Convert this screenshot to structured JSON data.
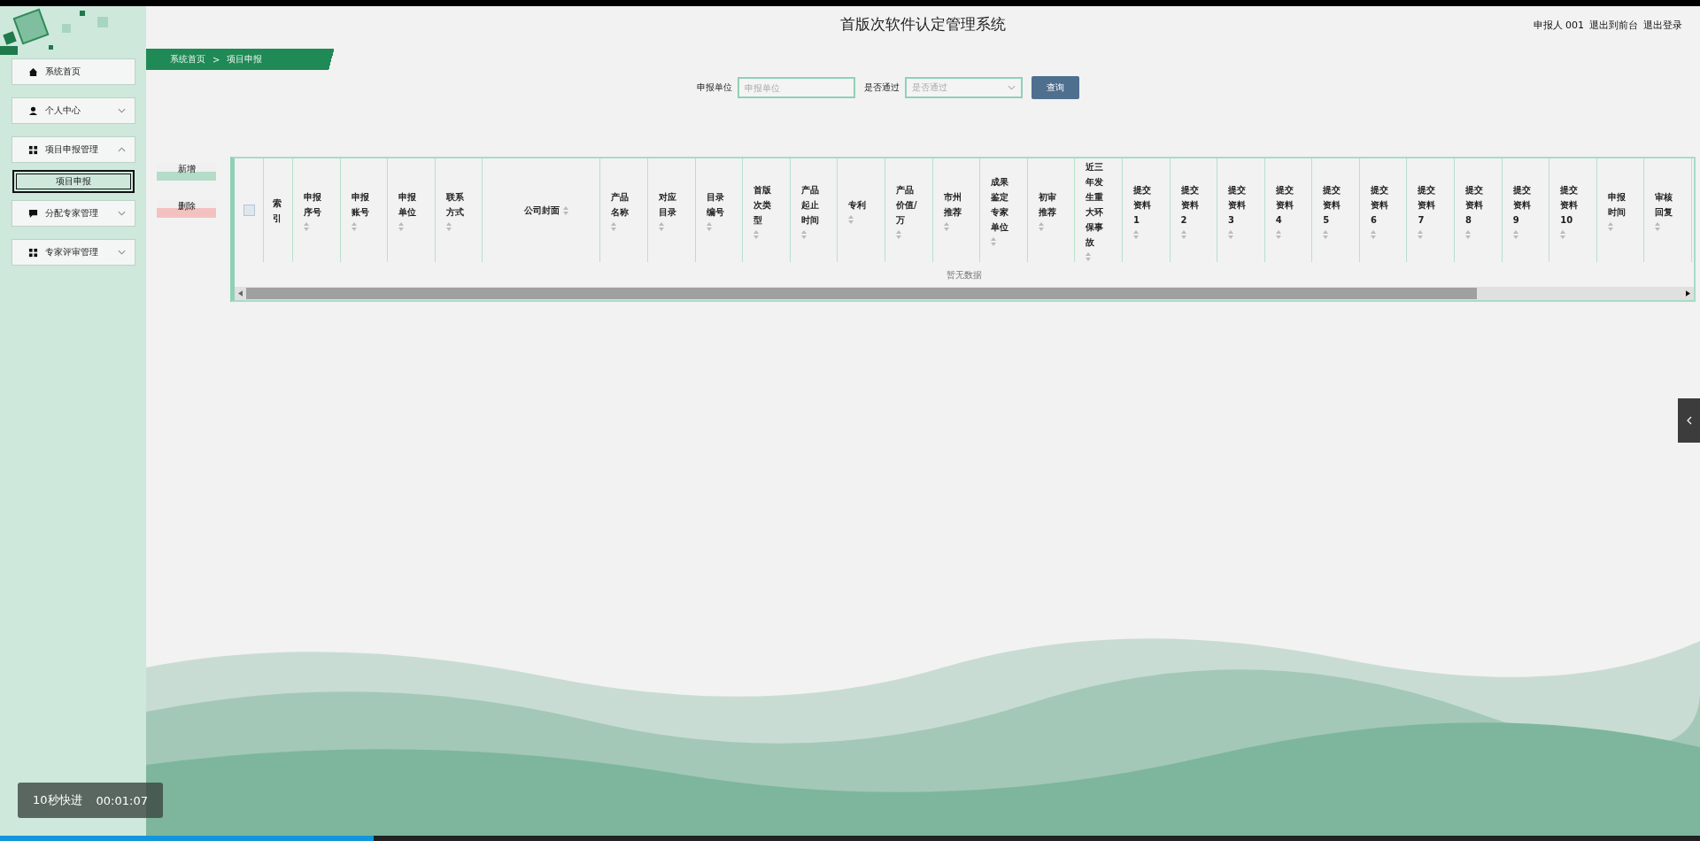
{
  "header": {
    "title": "首版次软件认定管理系统",
    "links": [
      "申报人 001",
      "退出到前台",
      "退出登录"
    ]
  },
  "breadcrumb": {
    "items": [
      "系统首页",
      "项目申报"
    ],
    "separator": ">"
  },
  "sidebar": {
    "items": [
      {
        "label": "系统首页",
        "kind": "link"
      },
      {
        "label": "个人中心",
        "kind": "menu",
        "expanded": false
      },
      {
        "label": "项目申报管理",
        "kind": "menu",
        "expanded": true,
        "children": [
          {
            "label": "项目申报",
            "selected": true
          }
        ]
      },
      {
        "label": "分配专家管理",
        "kind": "menu",
        "expanded": false
      },
      {
        "label": "专家评审管理",
        "kind": "menu",
        "expanded": false
      }
    ]
  },
  "search": {
    "fields": [
      {
        "label": "申报单位",
        "placeholder": "申报单位",
        "kind": "input"
      },
      {
        "label": "是否通过",
        "placeholder": "是否通过",
        "kind": "select"
      }
    ],
    "button": "查询"
  },
  "actions": [
    {
      "label": "新增",
      "kind": "add"
    },
    {
      "label": "删除",
      "kind": "delete"
    }
  ],
  "table": {
    "select_all": {
      "checked": false
    },
    "columns": [
      {
        "label": "索引",
        "sortable": false,
        "kind": "narrow"
      },
      {
        "label": "申报序号",
        "sortable": true
      },
      {
        "label": "申报账号",
        "sortable": true
      },
      {
        "label": "申报单位",
        "sortable": true
      },
      {
        "label": "联系方式",
        "sortable": true
      },
      {
        "label": "公司封面",
        "sortable": true,
        "kind": "wide"
      },
      {
        "label": "产品名称",
        "sortable": true
      },
      {
        "label": "对应目录",
        "sortable": true
      },
      {
        "label": "目录编号",
        "sortable": true
      },
      {
        "label": "首版次类型",
        "sortable": true
      },
      {
        "label": "产品起止时间",
        "sortable": true
      },
      {
        "label": "专利",
        "sortable": true
      },
      {
        "label": "产品价值/万",
        "sortable": true
      },
      {
        "label": "市州推荐",
        "sortable": true
      },
      {
        "label": "成果鉴定专家单位",
        "sortable": true
      },
      {
        "label": "初审推荐",
        "sortable": true
      },
      {
        "label": "近三年发生重大环保事故",
        "sortable": true
      },
      {
        "label": "提交资料1",
        "sortable": true
      },
      {
        "label": "提交资料2",
        "sortable": true
      },
      {
        "label": "提交资料3",
        "sortable": true
      },
      {
        "label": "提交资料4",
        "sortable": true
      },
      {
        "label": "提交资料5",
        "sortable": true
      },
      {
        "label": "提交资料6",
        "sortable": true
      },
      {
        "label": "提交资料7",
        "sortable": true
      },
      {
        "label": "提交资料8",
        "sortable": true
      },
      {
        "label": "提交资料9",
        "sortable": true
      },
      {
        "label": "提交资料10",
        "sortable": true
      },
      {
        "label": "申报时间",
        "sortable": true
      },
      {
        "label": "审核回复",
        "sortable": true
      }
    ],
    "empty_text": "暂无数据"
  },
  "player": {
    "hint": "10秒快进",
    "time": "00:01:07",
    "level": 0.22
  }
}
